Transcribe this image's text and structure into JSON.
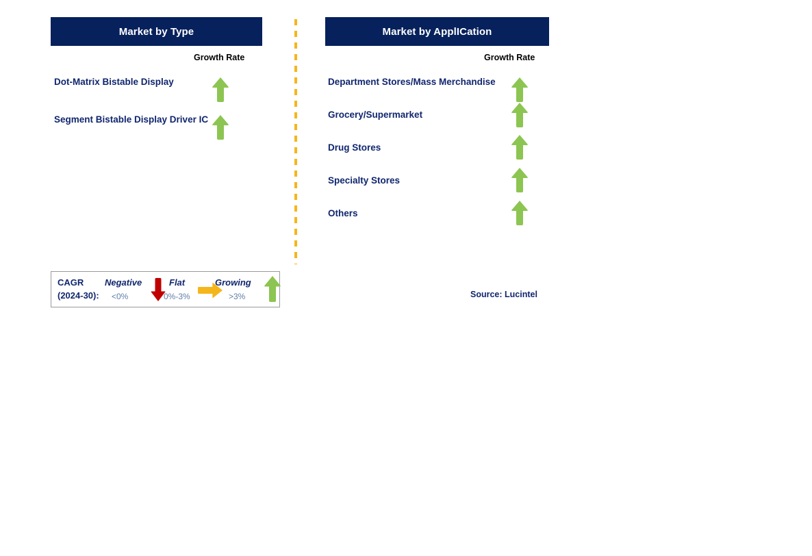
{
  "panels": [
    {
      "id": "type",
      "title": "Market by Type",
      "growth_rate_label": "Growth Rate",
      "rows": [
        {
          "label": "Dot-Matrix Bistable Display",
          "trend": "growing",
          "icon": "arrow-up-icon"
        },
        {
          "label": "Segment Bistable Display Driver IC",
          "trend": "growing",
          "icon": "arrow-up-icon"
        }
      ]
    },
    {
      "id": "application",
      "title": "Market by ApplICation",
      "growth_rate_label": "Growth Rate",
      "rows": [
        {
          "label": "Department Stores/Mass Merchandise",
          "trend": "growing",
          "icon": "arrow-up-icon"
        },
        {
          "label": "Grocery/Supermarket",
          "trend": "growing",
          "icon": "arrow-up-icon"
        },
        {
          "label": "Drug Stores",
          "trend": "growing",
          "icon": "arrow-up-icon"
        },
        {
          "label": "Specialty Stores",
          "trend": "growing",
          "icon": "arrow-up-icon"
        },
        {
          "label": "Others",
          "trend": "growing",
          "icon": "arrow-up-icon"
        }
      ]
    }
  ],
  "legend": {
    "title_line1": "CAGR",
    "title_line2": "(2024-30):",
    "entries": [
      {
        "name": "Negative",
        "range": "<0%",
        "icon": "arrow-down-icon",
        "color": "#c00000"
      },
      {
        "name": "Flat",
        "range": "0%-3%",
        "icon": "arrow-right-icon",
        "color": "#f5b61c"
      },
      {
        "name": "Growing",
        "range": ">3%",
        "icon": "arrow-up-icon",
        "color": "#8cc551"
      }
    ]
  },
  "source": "Source: Lucintel",
  "colors": {
    "header_bar": "#06215c",
    "label_navy": "#10266e",
    "growing_green": "#8cc551",
    "negative_red": "#c00000",
    "flat_amber": "#f5b61c",
    "divider_amber": "#f5b61c",
    "range_text": "#5f7da8"
  }
}
